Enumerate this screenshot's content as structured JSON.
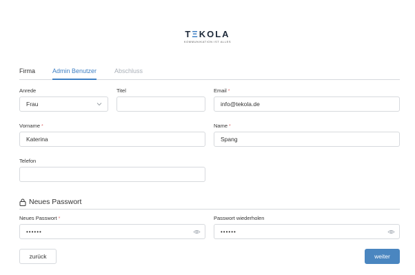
{
  "logo": {
    "name_part1": "T",
    "name_accent": "Ξ",
    "name_part2": "KOLA",
    "tagline": "KOMMUNIKATION IST ALLES"
  },
  "tabs": [
    {
      "label": "Firma",
      "state": "done"
    },
    {
      "label": "Admin Benutzer",
      "state": "active"
    },
    {
      "label": "Abschluss",
      "state": "disabled"
    }
  ],
  "form": {
    "anrede": {
      "label": "Anrede",
      "value": "Frau",
      "icon": "chevron-down-icon"
    },
    "titel": {
      "label": "Titel",
      "value": ""
    },
    "email": {
      "label": "Email",
      "required": "*",
      "value": "info@tekola.de"
    },
    "vorname": {
      "label": "Vorname",
      "required": "*",
      "value": "Katerina"
    },
    "name": {
      "label": "Name",
      "required": "*",
      "value": "Spang"
    },
    "telefon": {
      "label": "Telefon",
      "value": ""
    }
  },
  "password_section": {
    "title": "Neues Passwort",
    "icon": "lock-icon",
    "new_password": {
      "label": "Neues Passwort",
      "required": "*",
      "value": "••••••",
      "icon": "eye-icon"
    },
    "repeat_password": {
      "label": "Passwort wiederholen",
      "value": "••••••",
      "icon": "eye-icon"
    }
  },
  "buttons": {
    "back": "zurück",
    "next": "weiter"
  },
  "colors": {
    "accent": "#3d7fc4",
    "primary_button": "#4a86c0",
    "required": "#e07070",
    "disabled_tab": "#aab0b8"
  }
}
